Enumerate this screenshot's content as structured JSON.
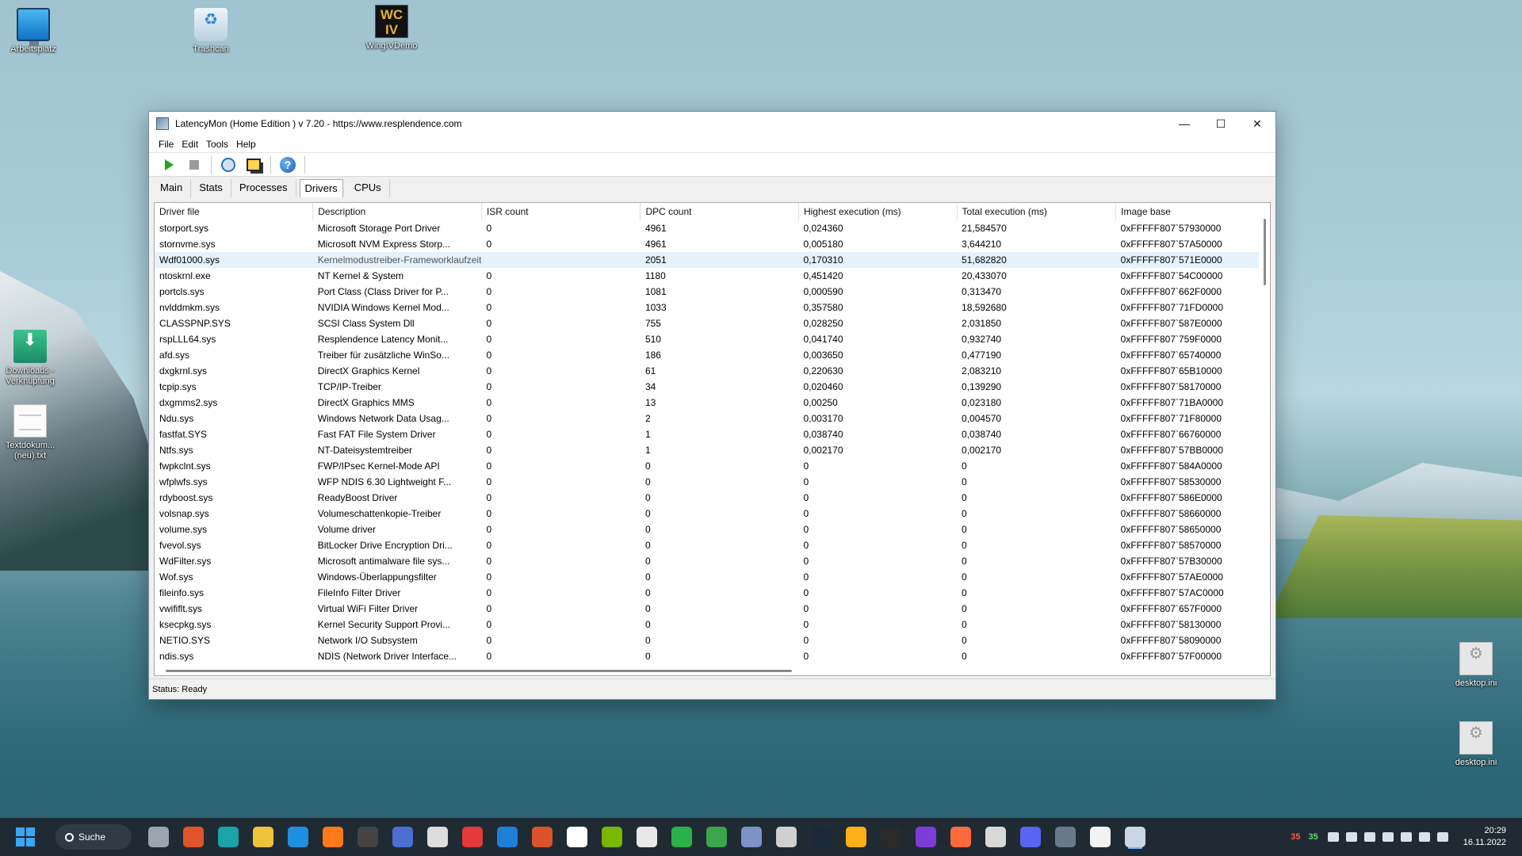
{
  "desktop": {
    "icons": [
      {
        "label": "Arbeitsplatz"
      },
      {
        "label": "Trashcan"
      },
      {
        "label": "WingIVDemo",
        "badge": "WC IV"
      },
      {
        "label": "Downloads - Verknüpfung"
      },
      {
        "label": "Textdokum... (neu).txt"
      },
      {
        "label": "desktop.ini"
      },
      {
        "label": "desktop.ini"
      }
    ]
  },
  "window": {
    "title": "LatencyMon  (Home Edition )  v 7.20 - https://www.resplendence.com",
    "controls": {
      "minimize": "—",
      "maximize": "☐",
      "close": "✕"
    },
    "menu": [
      "File",
      "Edit",
      "Tools",
      "Help"
    ],
    "toolbar": {
      "icons": [
        "play-icon",
        "stop-icon",
        "find-driver-icon",
        "windows-icon",
        "help-icon"
      ],
      "help_glyph": "?"
    },
    "tabs": [
      "Main",
      "Stats",
      "Processes",
      "Drivers",
      "CPUs"
    ],
    "active_tab": "Drivers",
    "table": {
      "columns": [
        "Driver file",
        "Description",
        "ISR count",
        "DPC count",
        "Highest execution (ms)",
        "Total execution (ms)",
        "Image base"
      ],
      "selected_row": 2,
      "rows": [
        [
          "storport.sys",
          "Microsoft Storage Port Driver",
          "0",
          "4961",
          "0,024360",
          "21,584570",
          "0xFFFFF807`57930000"
        ],
        [
          "stornvme.sys",
          "Microsoft NVM Express Storp...",
          "0",
          "4961",
          "0,005180",
          "3,644210",
          "0xFFFFF807`57A50000"
        ],
        [
          "Wdf01000.sys",
          "Kernelmodustreiber-Frameworklaufzeit",
          "",
          "2051",
          "0,170310",
          "51,682820",
          "0xFFFFF807`571E0000"
        ],
        [
          "ntoskrnl.exe",
          "NT Kernel & System",
          "0",
          "1180",
          "0,451420",
          "20,433070",
          "0xFFFFF807`54C00000"
        ],
        [
          "portcls.sys",
          "Port Class (Class Driver for P...",
          "0",
          "1081",
          "0,000590",
          "0,313470",
          "0xFFFFF807`662F0000"
        ],
        [
          "nvlddmkm.sys",
          "NVIDIA Windows Kernel Mod...",
          "0",
          "1033",
          "0,357580",
          "18,592680",
          "0xFFFFF807`71FD0000"
        ],
        [
          "CLASSPNP.SYS",
          "SCSI Class System Dll",
          "0",
          "755",
          "0,028250",
          "2,031850",
          "0xFFFFF807`587E0000"
        ],
        [
          "rspLLL64.sys",
          "Resplendence Latency Monit...",
          "0",
          "510",
          "0,041740",
          "0,932740",
          "0xFFFFF807`759F0000"
        ],
        [
          "afd.sys",
          "Treiber für zusätzliche WinSo...",
          "0",
          "186",
          "0,003650",
          "0,477190",
          "0xFFFFF807`65740000"
        ],
        [
          "dxgkrnl.sys",
          "DirectX Graphics Kernel",
          "0",
          "61",
          "0,220630",
          "2,083210",
          "0xFFFFF807`65B10000"
        ],
        [
          "tcpip.sys",
          "TCP/IP-Treiber",
          "0",
          "34",
          "0,020460",
          "0,139290",
          "0xFFFFF807`58170000"
        ],
        [
          "dxgmms2.sys",
          "DirectX Graphics MMS",
          "0",
          "13",
          "0,00250",
          "0,023180",
          "0xFFFFF807`71BA0000"
        ],
        [
          "Ndu.sys",
          "Windows Network Data Usag...",
          "0",
          "2",
          "0,003170",
          "0,004570",
          "0xFFFFF807`71F80000"
        ],
        [
          "fastfat.SYS",
          "Fast FAT File System Driver",
          "0",
          "1",
          "0,038740",
          "0,038740",
          "0xFFFFF807`66760000"
        ],
        [
          "Ntfs.sys",
          "NT-Dateisystemtreiber",
          "0",
          "1",
          "0,002170",
          "0,002170",
          "0xFFFFF807`57BB0000"
        ],
        [
          "fwpkclnt.sys",
          "FWP/IPsec Kernel-Mode API",
          "0",
          "0",
          "0",
          "0",
          "0xFFFFF807`584A0000"
        ],
        [
          "wfplwfs.sys",
          "WFP NDIS 6.30 Lightweight F...",
          "0",
          "0",
          "0",
          "0",
          "0xFFFFF807`58530000"
        ],
        [
          "rdyboost.sys",
          "ReadyBoost Driver",
          "0",
          "0",
          "0",
          "0",
          "0xFFFFF807`586E0000"
        ],
        [
          "volsnap.sys",
          "Volumeschattenkopie-Treiber",
          "0",
          "0",
          "0",
          "0",
          "0xFFFFF807`58660000"
        ],
        [
          "volume.sys",
          "Volume driver",
          "0",
          "0",
          "0",
          "0",
          "0xFFFFF807`58650000"
        ],
        [
          "fvevol.sys",
          "BitLocker Drive Encryption Dri...",
          "0",
          "0",
          "0",
          "0",
          "0xFFFFF807`58570000"
        ],
        [
          "WdFilter.sys",
          "Microsoft antimalware file sys...",
          "0",
          "0",
          "0",
          "0",
          "0xFFFFF807`57B30000"
        ],
        [
          "Wof.sys",
          "Windows-Überlappungsfilter",
          "0",
          "0",
          "0",
          "0",
          "0xFFFFF807`57AE0000"
        ],
        [
          "fileinfo.sys",
          "FileInfo Filter Driver",
          "0",
          "0",
          "0",
          "0",
          "0xFFFFF807`57AC0000"
        ],
        [
          "vwififlt.sys",
          "Virtual WiFi Filter Driver",
          "0",
          "0",
          "0",
          "0",
          "0xFFFFF807`657F0000"
        ],
        [
          "ksecpkg.sys",
          "Kernel Security Support Provi...",
          "0",
          "0",
          "0",
          "0",
          "0xFFFFF807`58130000"
        ],
        [
          "NETIO.SYS",
          "Network I/O Subsystem",
          "0",
          "0",
          "0",
          "0",
          "0xFFFFF807`58090000"
        ],
        [
          "ndis.sys",
          "NDIS (Network Driver Interface...",
          "0",
          "0",
          "0",
          "0",
          "0xFFFFF807`57F00000"
        ]
      ]
    },
    "status": "Status: Ready"
  },
  "taskbar": {
    "search_label": "Suche",
    "apps": [
      "task-view",
      "app-red",
      "app-teal",
      "file-explorer",
      "edge",
      "firefox",
      "obs",
      "save-app",
      "clapper",
      "app-red-square",
      "search-app",
      "app-orange",
      "app-fox",
      "nvidia",
      "app-badge",
      "app-green",
      "app-bars",
      "app-blue",
      "app-steam-like",
      "steam",
      "rockstar",
      "epic",
      "app-ring",
      "app-orange-ring",
      "app-spiral",
      "discord",
      "app-car",
      "notepad",
      "latencymon"
    ],
    "app_colors": [
      "#9aa4ad",
      "#e0542b",
      "#1aa3a8",
      "#f0c23c",
      "#1f8fe0",
      "#ff7a1a",
      "#444",
      "#4a6fd1",
      "#dddddd",
      "#e33b3b",
      "#1f7fd6",
      "#d9532c",
      "#ffffff",
      "#76b900",
      "#e8e8e8",
      "#2bb14a",
      "#3aa54a",
      "#7c93c8",
      "#d0d0d0",
      "#1b2838",
      "#fcaf17",
      "#2a2a2a",
      "#7b3dd6",
      "#ff6a3d",
      "#d8d8d8",
      "#5865f2",
      "#6a7a8a",
      "#f2f2f2",
      "#c9d6e3"
    ],
    "tray": {
      "num_red": "35",
      "num_green": "35",
      "time": "20:29",
      "date": "16.11.2022"
    }
  }
}
